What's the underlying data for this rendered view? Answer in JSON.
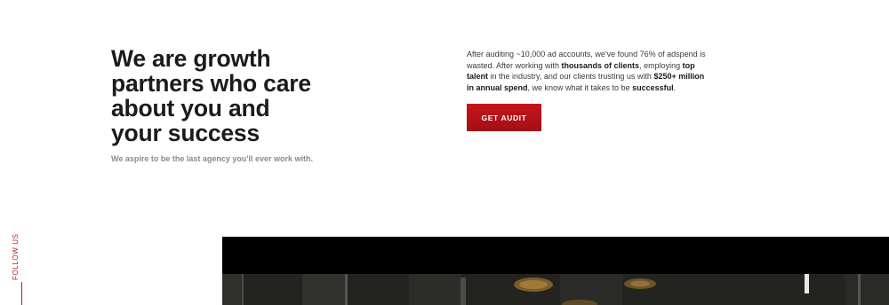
{
  "hero": {
    "headline_lines": [
      "We are growth",
      "partners who care",
      "about you and",
      "your success"
    ],
    "subline": "We aspire to be the last agency you'll ever work with."
  },
  "intro": {
    "segments": [
      {
        "text": "After auditing ~10,000 ad accounts, we've found 76% of adspend is wasted. After working with ",
        "bold": false
      },
      {
        "text": "thousands of clients",
        "bold": true
      },
      {
        "text": ", employing ",
        "bold": false
      },
      {
        "text": "top talent",
        "bold": true
      },
      {
        "text": " in the industry, and our clients trusting us with ",
        "bold": false
      },
      {
        "text": "$250+ million in annual spend",
        "bold": true
      },
      {
        "text": ", we know what it takes to be ",
        "bold": false
      },
      {
        "text": "successful",
        "bold": true
      },
      {
        "text": ".",
        "bold": false
      }
    ]
  },
  "cta": {
    "label": "GET AUDIT"
  },
  "social": {
    "label": "FOLLOW US"
  },
  "colors": {
    "accent": "#b81d22",
    "button": "#b3121a",
    "text": "#1b1b1b",
    "muted": "#8a8a8a"
  }
}
